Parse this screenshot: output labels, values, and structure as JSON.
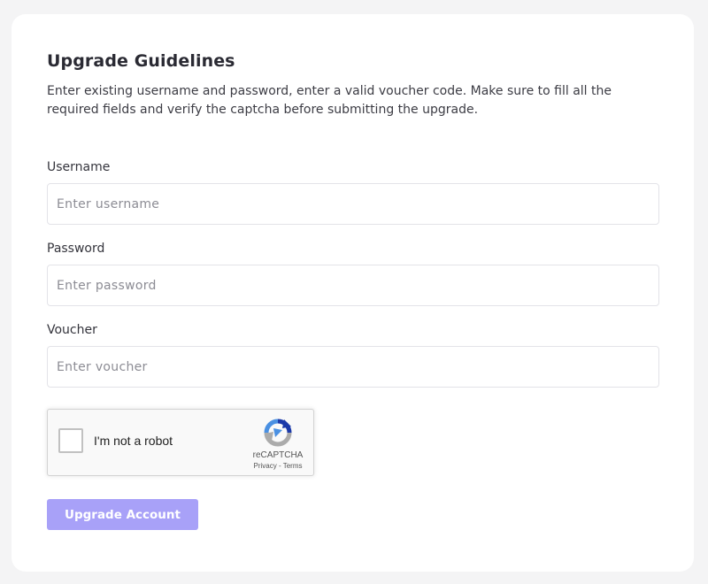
{
  "form": {
    "title": "Upgrade Guidelines",
    "description": "Enter existing username and password, enter a valid voucher code. Make sure to fill all the required fields and verify the captcha before submitting the upgrade."
  },
  "fields": {
    "username": {
      "label": "Username",
      "placeholder": "Enter username",
      "value": ""
    },
    "password": {
      "label": "Password",
      "placeholder": "Enter password",
      "value": ""
    },
    "voucher": {
      "label": "Voucher",
      "placeholder": "Enter voucher",
      "value": ""
    }
  },
  "captcha": {
    "label": "I'm not a robot",
    "brand": "reCAPTCHA",
    "privacy": "Privacy",
    "separator": " - ",
    "terms": "Terms",
    "checked": false,
    "icon": "recaptcha-logo-icon"
  },
  "submit": {
    "label": "Upgrade Account"
  },
  "colors": {
    "page_bg": "#f4f4f5",
    "card_bg": "#ffffff",
    "button_bg": "#a8a1f8",
    "button_text": "#ffffff",
    "input_border": "#e3e3e8"
  }
}
